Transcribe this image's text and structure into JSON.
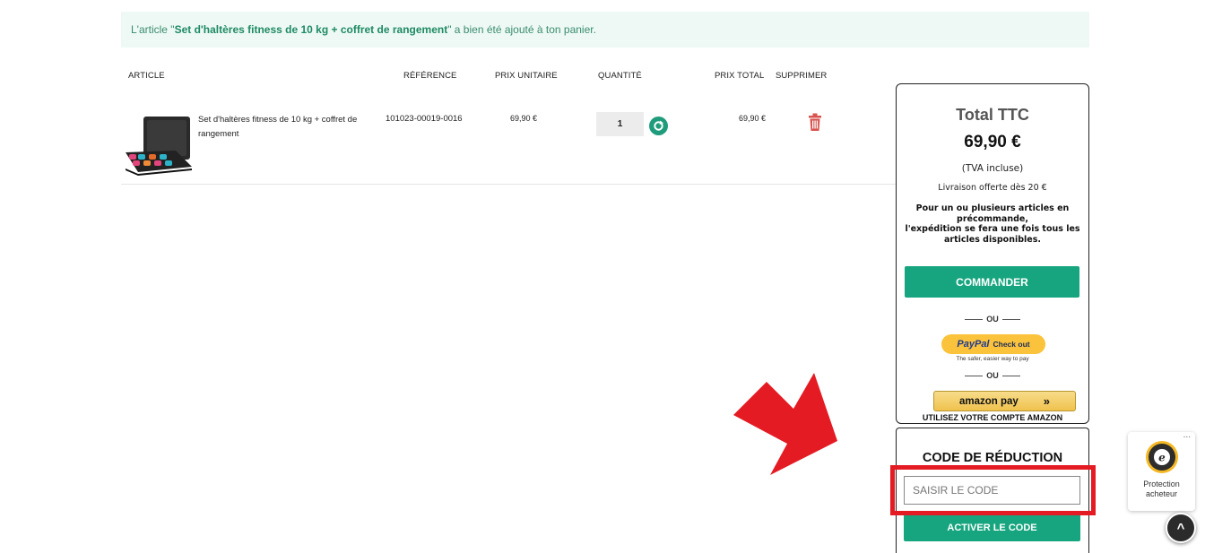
{
  "notice": {
    "prefix": "L'article \"",
    "product": "Set d'haltères fitness de 10 kg + coffret de rangement",
    "suffix": "\" a bien été ajouté à ton panier."
  },
  "table": {
    "headers": {
      "article": "ARTICLE",
      "reference": "RÉFÉRENCE",
      "unit_price": "PRIX UNITAIRE",
      "quantity": "QUANTITÉ",
      "total_price": "PRIX TOTAL",
      "delete": "SUPPRIMER"
    },
    "row": {
      "name": "Set d'haltères fitness de 10 kg + coffret de rangement",
      "reference": "101023-00019-0016",
      "unit_price": "69,90 €",
      "quantity": "1",
      "total_price": "69,90 €"
    }
  },
  "summary": {
    "total_label": "Total TTC",
    "total_value": "69,90 €",
    "tva": "(TVA incluse)",
    "livraison": "Livraison offerte dès 20 €",
    "precommande_1": "Pour un ou plusieurs articles en précommande,",
    "precommande_2": "l'expédition se fera une fois tous les articles disponibles.",
    "order_button": "COMMANDER",
    "or_1": "OU",
    "paypal_pay": "PayPal",
    "paypal_checkout": "Check out",
    "paypal_sub": "The safer, easier way to pay",
    "or_2": "OU",
    "amazon_label": "amazon pay",
    "amazon_note": "UTILISEZ VOTRE COMPTE AMAZON"
  },
  "promo": {
    "title": "CODE DE RÉDUCTION",
    "placeholder": "SAISIR LE CODE",
    "button": "ACTIVER LE CODE"
  },
  "trusted": {
    "label_1": "Protection",
    "label_2": "acheteur",
    "more": "...",
    "seal_text": "TRUSTED SHOPS GUARANTEE"
  },
  "scroll_top": {
    "label": "^"
  },
  "colors": {
    "brand_green": "#17a57f",
    "highlight_red": "#e41b23",
    "arrow_red": "#e41b23",
    "paypal_yellow": "#fbc33b",
    "amazon_gold": "#f0c24e",
    "trash_red": "#d9534f"
  },
  "icons": {
    "refresh": "refresh-icon",
    "trash": "trash-icon",
    "arrow": "arrow-annotation-icon",
    "trusted": "trusted-shops-seal-icon",
    "scroll": "chevron-up-icon"
  }
}
